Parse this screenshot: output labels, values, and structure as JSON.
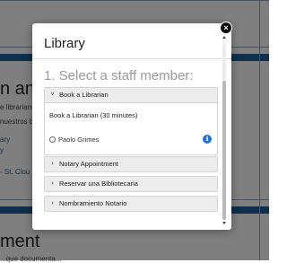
{
  "background": {
    "heading_top": "n and",
    "text_1": "e librarians",
    "text_2": "nuestros bi",
    "link_1": "ary",
    "link_2": "y",
    "link_3": "- St. Clou",
    "heading_bottom": "ment",
    "text_bottom": "...que documenta..."
  },
  "modal": {
    "title": "Library",
    "close_label": "×",
    "step_title": "1. Select a staff member:",
    "services": [
      {
        "label": "Book a Librarian",
        "expanded": true,
        "detail": "Book a Librarian (30 minutes)",
        "staff": [
          {
            "name": "Paolo Grimes",
            "info": "i"
          }
        ]
      },
      {
        "label": "Notary Appointment",
        "expanded": false
      },
      {
        "label": "Reservar una Bibliotecaria",
        "expanded": false
      },
      {
        "label": "Nombramiento Notario",
        "expanded": false
      }
    ]
  },
  "icons": {
    "expanded": "chevron-down-icon",
    "collapsed": "chevron-right-icon",
    "close": "close-icon",
    "info": "info-icon"
  },
  "colors": {
    "accent_bar": "#1f5f99",
    "info_blue": "#1e73d6",
    "overlay": "rgba(0,0,0,0.5)"
  }
}
